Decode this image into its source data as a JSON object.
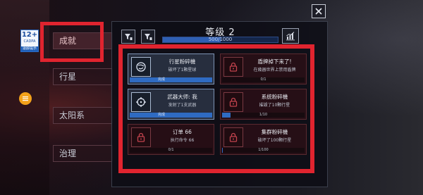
{
  "age_rating": {
    "age": "12+",
    "note": "CADPA",
    "label": "适龄提示"
  },
  "side_menu": [
    {
      "label": "成就",
      "active": true
    },
    {
      "label": "行星",
      "active": false
    },
    {
      "label": "太阳系",
      "active": false
    },
    {
      "label": "治理",
      "active": false
    }
  ],
  "panel": {
    "level_title": "等级 2",
    "level_progress": "500/1000",
    "level_fraction": 0.5
  },
  "cards": [
    {
      "title": "行星粉碎機",
      "desc": "破坏了1颗星球",
      "progress": "完成",
      "fraction": 1,
      "done": true,
      "icon": "planet-icon"
    },
    {
      "title": "盾牌掉下来了!",
      "desc": "在幾器世界上禁用盾牌",
      "progress": "0/1",
      "fraction": 0,
      "done": false,
      "icon": "lock-icon"
    },
    {
      "title": "武器大师: 我",
      "desc": "发射了1支武器",
      "progress": "完成",
      "fraction": 1,
      "done": true,
      "icon": "crosshair-icon"
    },
    {
      "title": "系统粉碎機",
      "desc": "摧毁了10颗行星",
      "progress": "1/10",
      "fraction": 0.1,
      "done": false,
      "icon": "lock-icon"
    },
    {
      "title": "订单 66",
      "desc": "执行命令 66",
      "progress": "0/1",
      "fraction": 0,
      "done": false,
      "icon": "lock-icon"
    },
    {
      "title": "集群粉碎機",
      "desc": "破坏了100颗行星",
      "progress": "1/100",
      "fraction": 0.01,
      "done": false,
      "icon": "lock-icon"
    }
  ],
  "colors": {
    "highlight": "#e0242f",
    "progress": "#2f6bc2",
    "accent": "#f3a21a"
  }
}
